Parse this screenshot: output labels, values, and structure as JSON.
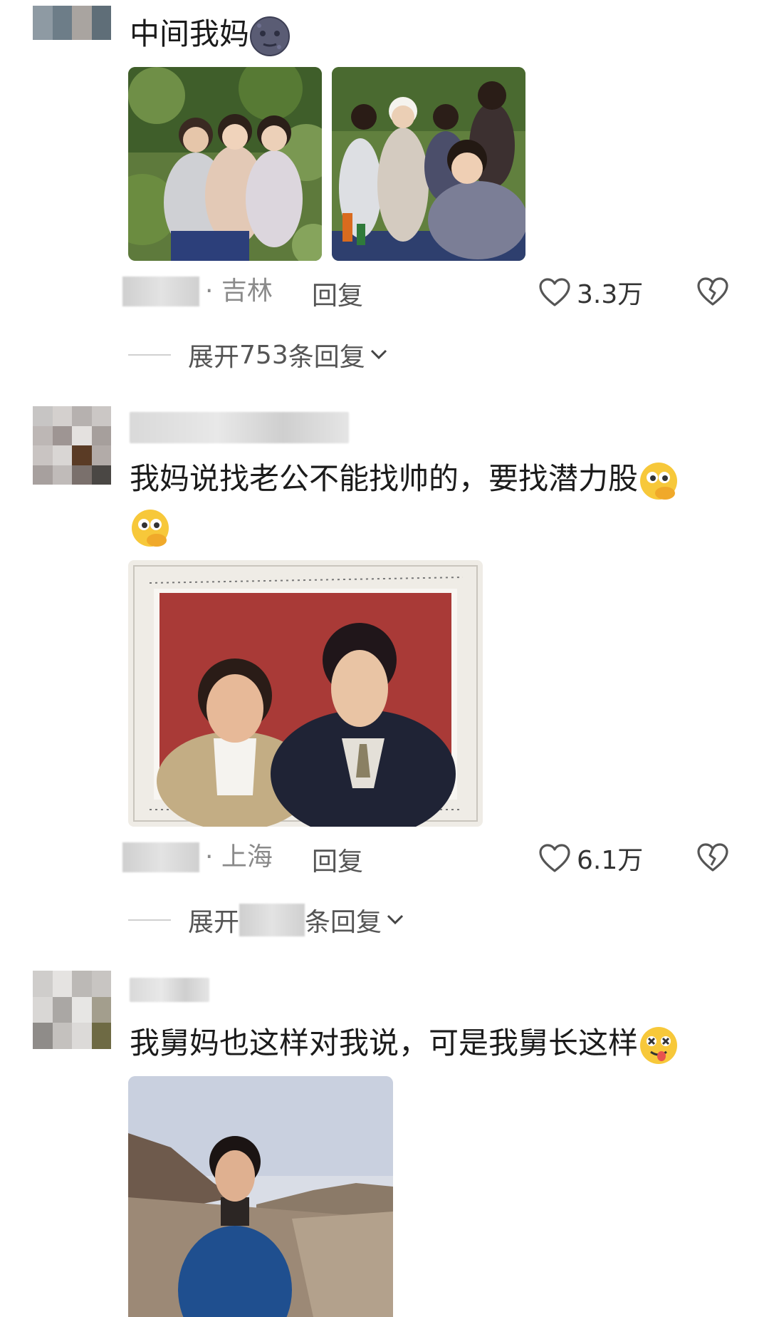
{
  "comments": [
    {
      "text": "中间我妈",
      "location": "· 吉林",
      "reply_label": "回复",
      "like_count": "3.3万",
      "expand_prefix": "展开",
      "expand_count": "753",
      "expand_suffix": "条回复",
      "emoji": "moon-face-emoji"
    },
    {
      "text_line1": "我妈说找老公不能找帅的，要找潜力股",
      "location": "· 上海",
      "reply_label": "回复",
      "like_count": "6.1万",
      "expand_prefix": "展开",
      "expand_suffix": "条回复",
      "emoji": "peeking-face-emoji"
    },
    {
      "text": "我舅妈也这样对我说，可是我舅长这样",
      "emoji": "dizzy-tongue-face-emoji"
    }
  ],
  "colors": {
    "text_primary": "#1b1b1b",
    "text_meta": "#8a8a8a",
    "divider": "#d0d0d0"
  }
}
